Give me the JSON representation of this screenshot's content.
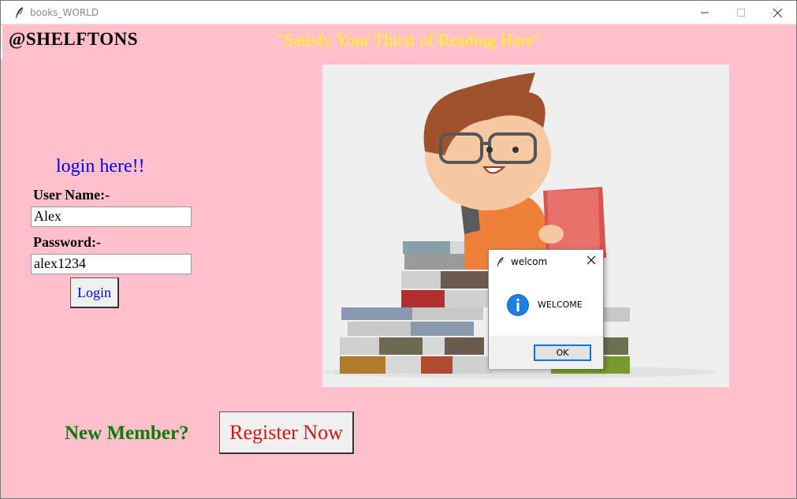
{
  "window": {
    "title": "books_WORLD",
    "minimize": "minimize",
    "maximize": "maximize",
    "close": "close"
  },
  "header": {
    "brand": "@SHELFTONS",
    "tagline": "\"Satisfy Your Thirst of Reading Here\""
  },
  "login": {
    "title": "login here!!",
    "username_label": "User Name:-",
    "username_value": "Alex",
    "password_label": "Password:-",
    "password_value": "alex1234",
    "button": "Login"
  },
  "register": {
    "prompt": "New Member?",
    "button": "Register Now"
  },
  "dialog": {
    "title": "welcom",
    "message": "WELCOME",
    "ok": "OK"
  },
  "colors": {
    "background": "#ffc0cb",
    "tagline": "#ffff00",
    "login_title": "#0000ff",
    "new_member": "#0a7a0a",
    "register": "#e01010"
  },
  "icons": {
    "app": "feather-icon",
    "dialog_info": "info-icon"
  }
}
